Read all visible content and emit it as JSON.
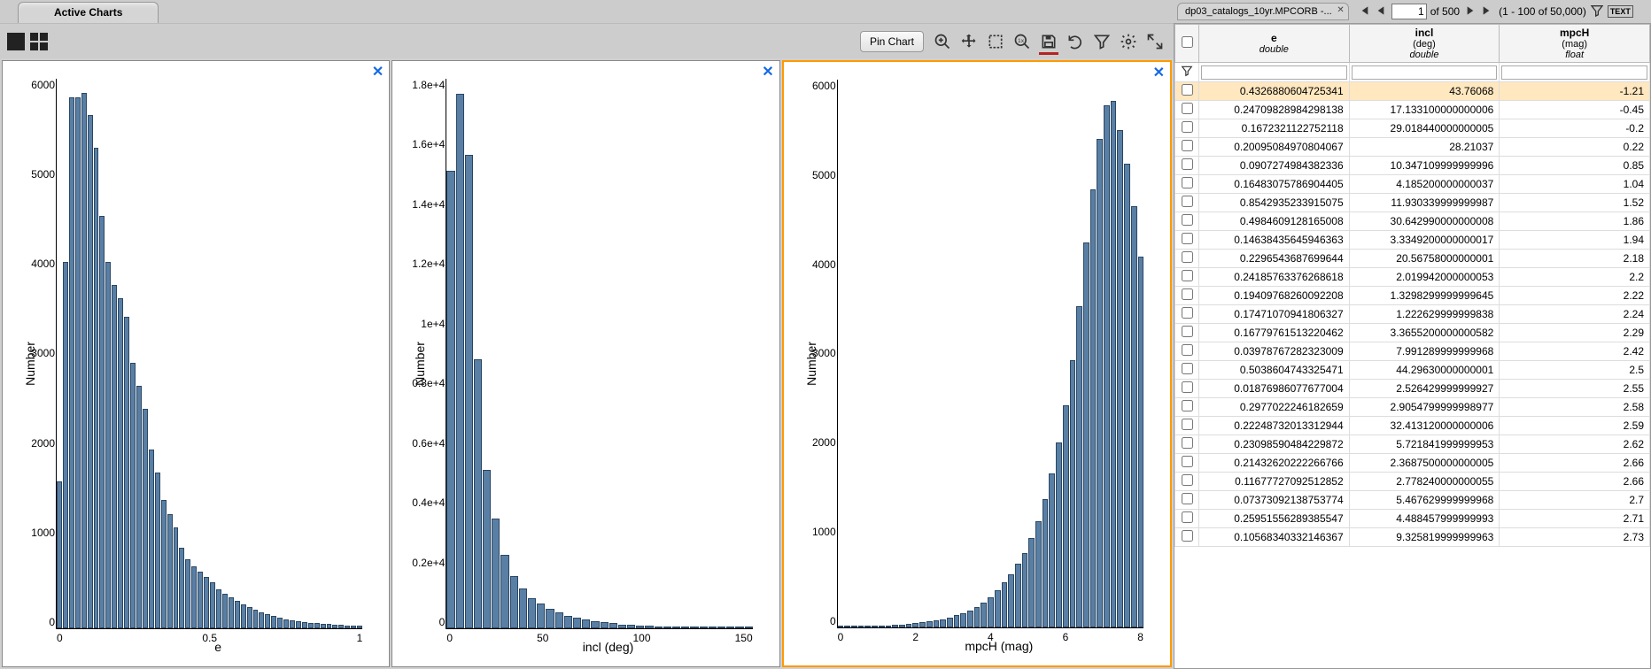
{
  "tab_title": "Active Charts",
  "pin_label": "Pin Chart",
  "ylabel": "Number",
  "right_tab": "dp03_catalogs_10yr.MPCORB -...",
  "page_current": "1",
  "page_of": "of 500",
  "page_range": "(1 - 100 of 50,000)",
  "columns": [
    {
      "name": "e",
      "units": "",
      "type": "double"
    },
    {
      "name": "incl",
      "units": "(deg)",
      "type": "double"
    },
    {
      "name": "mpcH",
      "units": "(mag)",
      "type": "float"
    }
  ],
  "rows": [
    {
      "e": "0.4326880604725341",
      "incl": "43.76068",
      "mpcH": "-1.21",
      "sel": true
    },
    {
      "e": "0.24709828984298138",
      "incl": "17.133100000000006",
      "mpcH": "-0.45"
    },
    {
      "e": "0.1672321122752118",
      "incl": "29.018440000000005",
      "mpcH": "-0.2"
    },
    {
      "e": "0.20095084970804067",
      "incl": "28.21037",
      "mpcH": "0.22"
    },
    {
      "e": "0.0907274984382336",
      "incl": "10.347109999999996",
      "mpcH": "0.85"
    },
    {
      "e": "0.16483075786904405",
      "incl": "4.185200000000037",
      "mpcH": "1.04"
    },
    {
      "e": "0.8542935233915075",
      "incl": "11.930339999999987",
      "mpcH": "1.52"
    },
    {
      "e": "0.4984609128165008",
      "incl": "30.642990000000008",
      "mpcH": "1.86"
    },
    {
      "e": "0.14638435645946363",
      "incl": "3.3349200000000017",
      "mpcH": "1.94"
    },
    {
      "e": "0.2296543687699644",
      "incl": "20.56758000000001",
      "mpcH": "2.18"
    },
    {
      "e": "0.24185763376268618",
      "incl": "2.019942000000053",
      "mpcH": "2.2"
    },
    {
      "e": "0.19409768260092208",
      "incl": "1.3298299999999645",
      "mpcH": "2.22"
    },
    {
      "e": "0.17471070941806327",
      "incl": "1.222629999999838",
      "mpcH": "2.24"
    },
    {
      "e": "0.16779761513220462",
      "incl": "3.3655200000000582",
      "mpcH": "2.29"
    },
    {
      "e": "0.03978767282323009",
      "incl": "7.991289999999968",
      "mpcH": "2.42"
    },
    {
      "e": "0.5038604743325471",
      "incl": "44.29630000000001",
      "mpcH": "2.5"
    },
    {
      "e": "0.01876986077677004",
      "incl": "2.526429999999927",
      "mpcH": "2.55"
    },
    {
      "e": "0.2977022246182659",
      "incl": "2.9054799999998977",
      "mpcH": "2.58"
    },
    {
      "e": "0.22248732013312944",
      "incl": "32.413120000000006",
      "mpcH": "2.59"
    },
    {
      "e": "0.23098590484229872",
      "incl": "5.721841999999953",
      "mpcH": "2.62"
    },
    {
      "e": "0.21432620222266766",
      "incl": "2.3687500000000005",
      "mpcH": "2.66"
    },
    {
      "e": "0.11677727092512852",
      "incl": "2.778240000000055",
      "mpcH": "2.66"
    },
    {
      "e": "0.07373092138753774",
      "incl": "5.467629999999968",
      "mpcH": "2.7"
    },
    {
      "e": "0.25951556289385547",
      "incl": "4.488457999999993",
      "mpcH": "2.71"
    },
    {
      "e": "0.10568340332146367",
      "incl": "9.325819999999963",
      "mpcH": "2.73"
    }
  ],
  "chart_data": [
    {
      "type": "bar",
      "xlabel": "e",
      "title": "",
      "ylim": [
        0,
        6000
      ],
      "xlim": [
        0,
        1
      ],
      "yticks": [
        6000,
        5000,
        4000,
        3000,
        2000,
        1000,
        0
      ],
      "xticks": [
        0,
        0.5,
        1
      ],
      "values": [
        1600,
        4000,
        5800,
        5800,
        5850,
        5600,
        5250,
        4500,
        4000,
        3750,
        3600,
        3400,
        2900,
        2650,
        2400,
        1950,
        1700,
        1400,
        1250,
        1100,
        880,
        750,
        680,
        620,
        560,
        500,
        430,
        380,
        340,
        300,
        260,
        230,
        200,
        170,
        150,
        140,
        120,
        100,
        90,
        80,
        70,
        60,
        55,
        50,
        45,
        40,
        35,
        30,
        28,
        25
      ]
    },
    {
      "type": "bar",
      "xlabel": "incl (deg)",
      "title": "",
      "ylim": [
        0,
        18000
      ],
      "xlim": [
        0,
        170
      ],
      "yticks": [
        "1.8e+4",
        "1.6e+4",
        "1.4e+4",
        "1.2e+4",
        "1e+4",
        "0.8e+4",
        "0.6e+4",
        "0.4e+4",
        "0.2e+4",
        "0"
      ],
      "xticks": [
        0,
        50,
        100,
        150
      ],
      "values": [
        15000,
        17500,
        15500,
        8800,
        5200,
        3600,
        2400,
        1700,
        1300,
        1000,
        800,
        640,
        520,
        420,
        350,
        280,
        230,
        190,
        160,
        130,
        110,
        90,
        75,
        62,
        50,
        42,
        35,
        30,
        25,
        20,
        17,
        15,
        13,
        11
      ]
    },
    {
      "type": "bar",
      "xlabel": "mpcH (mag)",
      "title": "",
      "ylim": [
        0,
        6500
      ],
      "xlim": [
        -0.5,
        8.5
      ],
      "yticks": [
        6000,
        5000,
        4000,
        3000,
        2000,
        1000,
        0
      ],
      "xticks": [
        0,
        2,
        4,
        6,
        8
      ],
      "values": [
        5,
        6,
        8,
        10,
        13,
        16,
        20,
        24,
        28,
        33,
        40,
        48,
        58,
        69,
        83,
        99,
        119,
        142,
        170,
        203,
        244,
        293,
        360,
        444,
        534,
        630,
        760,
        880,
        1060,
        1260,
        1520,
        1830,
        2200,
        2640,
        3170,
        3810,
        4570,
        5200,
        5800,
        6200,
        6250,
        5900,
        5500,
        5000,
        4400
      ]
    }
  ]
}
